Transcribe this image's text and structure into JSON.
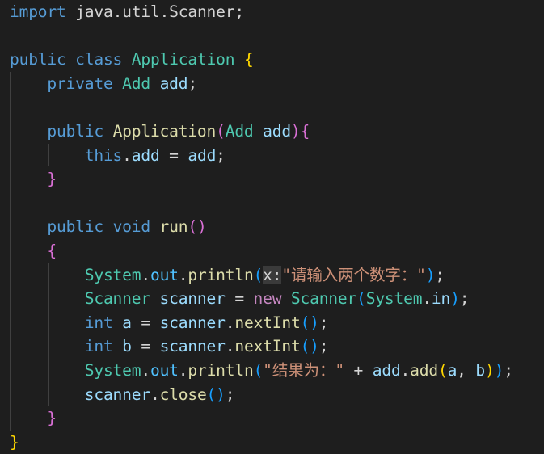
{
  "editor": {
    "theme_colors": {
      "background": "#1e1e1e",
      "keyword": "#569cd6",
      "type": "#4ec9b0",
      "string": "#ce9178",
      "function": "#dcdcaa",
      "variable": "#9cdcfe"
    },
    "lines": [
      [
        [
          "import",
          "kw"
        ],
        [
          " java.util.Scanner;",
          "p"
        ]
      ],
      [],
      [
        [
          "public class ",
          "kw"
        ],
        [
          "Application ",
          "type"
        ],
        [
          "{",
          "b1"
        ]
      ],
      [
        [
          "    private ",
          "kw"
        ],
        [
          "Add ",
          "type"
        ],
        [
          "add",
          "var"
        ],
        [
          ";",
          "p"
        ]
      ],
      [],
      [
        [
          "    public ",
          "kw"
        ],
        [
          "Application",
          "fn"
        ],
        [
          "(",
          "b2"
        ],
        [
          "Add ",
          "type"
        ],
        [
          "add",
          "var"
        ],
        [
          ")",
          "b2"
        ],
        [
          "{",
          "b2"
        ]
      ],
      [
        [
          "        this",
          "kw"
        ],
        [
          ".",
          "p"
        ],
        [
          "add",
          "var"
        ],
        [
          " = ",
          "p"
        ],
        [
          "add",
          "var"
        ],
        [
          ";",
          "p"
        ]
      ],
      [
        [
          "    }",
          "b2"
        ]
      ],
      [],
      [
        [
          "    public ",
          "kw"
        ],
        [
          "void ",
          "kw"
        ],
        [
          "run",
          "fn"
        ],
        [
          "()",
          "b2"
        ]
      ],
      [
        [
          "    {",
          "b2"
        ]
      ],
      [
        [
          "        System",
          "type"
        ],
        [
          ".",
          "p"
        ],
        [
          "out",
          "const"
        ],
        [
          ".",
          "p"
        ],
        [
          "println",
          "fn"
        ],
        [
          "(",
          "b3"
        ],
        [
          "x:",
          "hint"
        ],
        [
          "\"请输入两个数字：\"",
          "str"
        ],
        [
          ")",
          "b3"
        ],
        [
          ";",
          "p"
        ]
      ],
      [
        [
          "        Scanner ",
          "type"
        ],
        [
          "scanner",
          "var"
        ],
        [
          " = ",
          "p"
        ],
        [
          "new ",
          "ctrl"
        ],
        [
          "Scanner",
          "type"
        ],
        [
          "(",
          "b3"
        ],
        [
          "System",
          "type"
        ],
        [
          ".",
          "p"
        ],
        [
          "in",
          "var"
        ],
        [
          ")",
          "b3"
        ],
        [
          ";",
          "p"
        ]
      ],
      [
        [
          "        int ",
          "kw"
        ],
        [
          "a",
          "var"
        ],
        [
          " = ",
          "p"
        ],
        [
          "scanner",
          "var"
        ],
        [
          ".",
          "p"
        ],
        [
          "nextInt",
          "fn"
        ],
        [
          "()",
          "b3"
        ],
        [
          ";",
          "p"
        ]
      ],
      [
        [
          "        int ",
          "kw"
        ],
        [
          "b",
          "var"
        ],
        [
          " = ",
          "p"
        ],
        [
          "scanner",
          "var"
        ],
        [
          ".",
          "p"
        ],
        [
          "nextInt",
          "fn"
        ],
        [
          "()",
          "b3"
        ],
        [
          ";",
          "p"
        ]
      ],
      [
        [
          "        System",
          "type"
        ],
        [
          ".",
          "p"
        ],
        [
          "out",
          "const"
        ],
        [
          ".",
          "p"
        ],
        [
          "println",
          "fn"
        ],
        [
          "(",
          "b3"
        ],
        [
          "\"结果为：\"",
          "str"
        ],
        [
          " + ",
          "p"
        ],
        [
          "add",
          "var"
        ],
        [
          ".",
          "p"
        ],
        [
          "add",
          "fn"
        ],
        [
          "(",
          "b1"
        ],
        [
          "a",
          "var"
        ],
        [
          ", ",
          "p"
        ],
        [
          "b",
          "var"
        ],
        [
          ")",
          "b1"
        ],
        [
          ")",
          "b3"
        ],
        [
          ";",
          "p"
        ]
      ],
      [
        [
          "        scanner",
          "var"
        ],
        [
          ".",
          "p"
        ],
        [
          "close",
          "fn"
        ],
        [
          "()",
          "b3"
        ],
        [
          ";",
          "p"
        ]
      ],
      [
        [
          "    }",
          "b2"
        ]
      ],
      [
        [
          "}",
          "b1"
        ]
      ]
    ]
  }
}
